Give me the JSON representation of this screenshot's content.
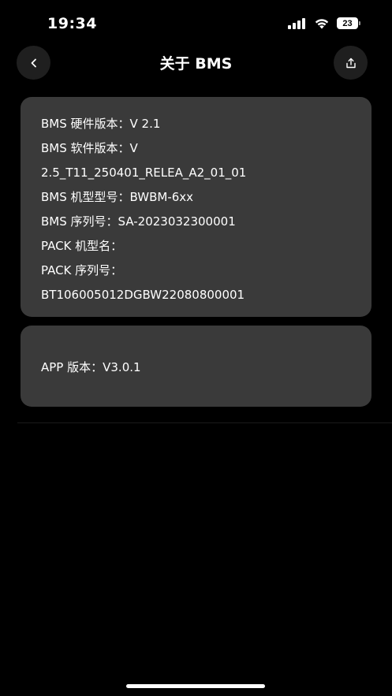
{
  "status_bar": {
    "time": "19:34",
    "battery_level": "23",
    "icons": [
      "signal-icon",
      "wifi-icon",
      "battery-icon"
    ]
  },
  "header": {
    "title": "关于 BMS",
    "back_icon": "chevron-left-icon",
    "share_icon": "share-icon"
  },
  "bms_info": {
    "lines": [
      "BMS 硬件版本：V 2.1",
      "BMS 软件版本：V",
      "2.5_T11_250401_RELEA_A2_01_01",
      "BMS 机型型号：BWBM-6xx",
      "BMS 序列号：SA-2023032300001",
      "PACK 机型名：",
      "PACK 序列号：",
      "BT106005012DGBW22080800001"
    ]
  },
  "app_info": {
    "version_line": "APP 版本：V3.0.1"
  },
  "colors": {
    "background": "#000000",
    "card": "#3a3a3a",
    "nav_button": "#1f1f1f",
    "text": "#ffffff"
  }
}
